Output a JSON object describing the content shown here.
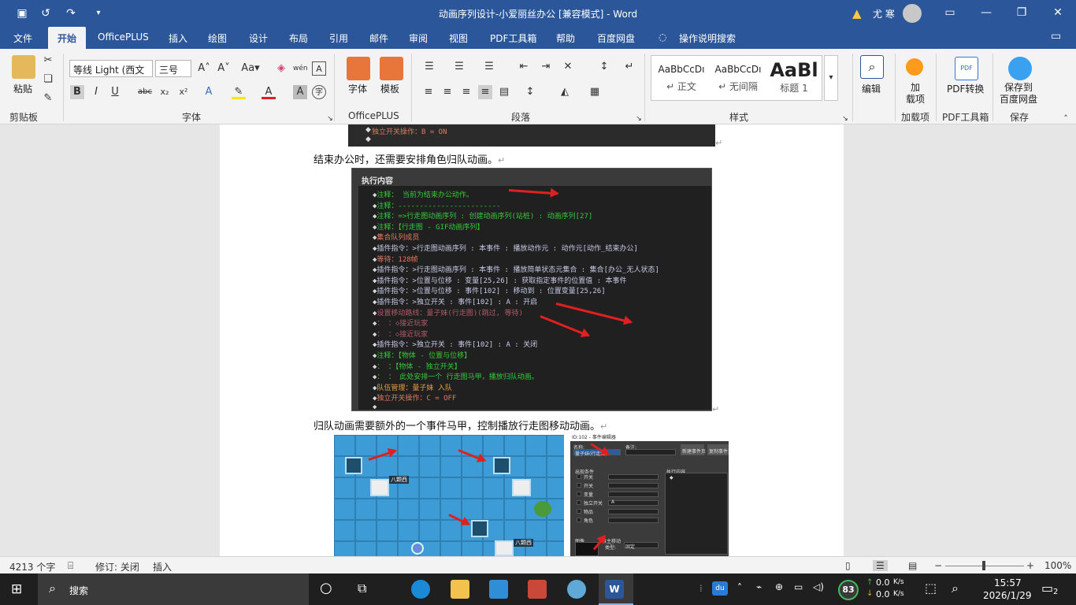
{
  "window": {
    "title": "动画序列设计-小爱丽丝办公 [兼容模式]  -  Word",
    "user": "尤 寒"
  },
  "menu_tabs": [
    "文件",
    "开始",
    "OfficePLUS",
    "插入",
    "绘图",
    "设计",
    "布局",
    "引用",
    "邮件",
    "审阅",
    "视图",
    "PDF工具箱",
    "帮助",
    "百度网盘",
    "操作说明搜索"
  ],
  "ribbon": {
    "clipboard": {
      "paste": "粘贴",
      "label": "剪贴板"
    },
    "font": {
      "name": "等线 Light (西文",
      "size": "三号",
      "label": "字体"
    },
    "officeplus": {
      "font_btn": "字体",
      "template_btn": "模板",
      "label": "OfficePLUS"
    },
    "paragraph": {
      "label": "段落"
    },
    "styles": {
      "label": "样式",
      "items": [
        {
          "sample": "AaBbCcDı",
          "name": "↵ 正文"
        },
        {
          "sample": "AaBbCcDı",
          "name": "↵ 无间隔"
        },
        {
          "sample": "AaBl",
          "name": "标题 1"
        }
      ]
    },
    "edit": {
      "label": "编辑"
    },
    "addins": {
      "btn": "加\n载项",
      "label": "加载项"
    },
    "pdf": {
      "btn": "PDF转换",
      "label": "PDF工具箱"
    },
    "save": {
      "btn": "保存到\n百度网盘",
      "label": "保存"
    }
  },
  "document": {
    "top_code_line": "独立开关操作：B = ON",
    "para1": "结束办公时，还需要安排角色归队动画。",
    "panel_title": "执行内容",
    "code_lines": [
      {
        "text": "注释：    当前为结束办公动作。",
        "color": "#35c83a"
      },
      {
        "text": "注释：------------------------",
        "color": "#35c83a"
      },
      {
        "text": "注释：=>行走图动画序列 : 创建动画序列(站桩) : 动画序列[27]",
        "color": "#35c83a"
      },
      {
        "text": "注释：【行走图 - GIF动画序列】",
        "color": "#35c83a"
      },
      {
        "text": "集合队列成员",
        "color": "#e07a5f"
      },
      {
        "text": "插件指令：>行走图动画序列 : 本事件 : 播放动作元 : 动作元[动作_结束办公]",
        "color": "#c9c9e8"
      },
      {
        "text": "等待：128帧",
        "color": "#e07a5f"
      },
      {
        "text": "插件指令：>行走图动画序列 : 本事件 : 播放简单状态元集合 : 集合[办公_无人状态]",
        "color": "#c9c9e8"
      },
      {
        "text": "插件指令：>位置与位移 : 变量[25,26] : 获取指定事件的位置值 : 本事件",
        "color": "#c9c9e8"
      },
      {
        "text": "插件指令：>位置与位移 : 事件[102] : 移动到 : 位置变量[25,26]",
        "color": "#c9c9e8"
      },
      {
        "text": "插件指令：>独立开关 : 事件[102] : A : 开启",
        "color": "#c9c9e8"
      },
      {
        "text": "设置移动路线：量子妹(行走图)(跳过, 等待)",
        "color": "#b05a6a"
      },
      {
        "text": "：            ：◇接近玩家",
        "color": "#b05a6a"
      },
      {
        "text": "：            ：◇接近玩家",
        "color": "#b05a6a"
      },
      {
        "text": "插件指令：>独立开关 : 事件[102] : A : 关闭",
        "color": "#c9c9e8"
      },
      {
        "text": "注释：【物体 - 位置与位移】",
        "color": "#35c83a"
      },
      {
        "text": "：    ：【物体 - 独立开关】",
        "color": "#35c83a"
      },
      {
        "text": "：    ：    此处安排一个 行走图马甲，播放归队动画。",
        "color": "#35c83a"
      },
      {
        "text": "队伍管理：量子妹 入队",
        "color": "#e8a040"
      },
      {
        "text": "独立开关操作：C = OFF",
        "color": "#e07a5f"
      },
      {
        "text": "",
        "color": "#d8d8d8"
      }
    ],
    "para2": "归队动画需要额外的一个事件马甲，控制播放行走图移动动画。",
    "map_tags": [
      "八颗西",
      "八颗西"
    ],
    "editor": {
      "title": "ID:102 - 事件编辑器",
      "name_label": "名称:",
      "name_value": "量子妹(行走图)",
      "note_label": "备注:",
      "btn_new": "新建事件页",
      "btn_copy": "复制事件页",
      "conditions": "出现条件",
      "rows": [
        "开关",
        "开关",
        "变量",
        "独立开关",
        "物品",
        "角色"
      ],
      "switch_value": "A",
      "exec": "执行内容",
      "image": "图像",
      "auto_move": "自主移动",
      "type_label": "类型:",
      "type_value": "固定"
    }
  },
  "statusbar": {
    "words": "4213 个字",
    "track": "修订: 关闭",
    "mode": "插入",
    "zoom": "100%"
  },
  "taskbar": {
    "search": "搜索",
    "badge": "83",
    "net_up": "0.0",
    "net_down": "0.0",
    "net_unit": "K/s",
    "time": "15:57",
    "date": "2026/1/29",
    "notif": "2",
    "du": "du"
  },
  "colors": {
    "word_blue": "#2b579a",
    "arrow_red": "#e02020",
    "taskbar": "#1f1f1f"
  }
}
